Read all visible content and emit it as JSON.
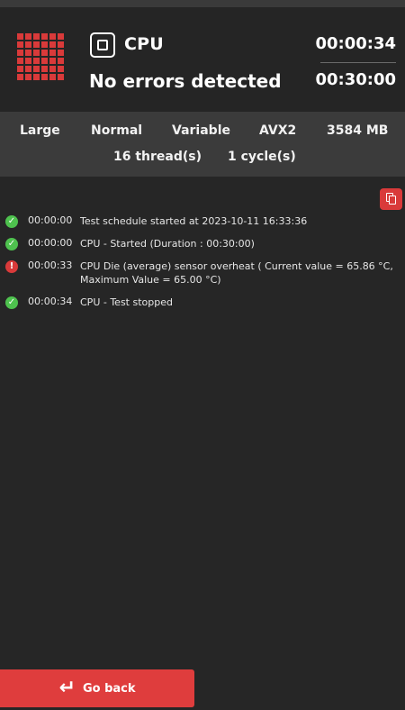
{
  "header": {
    "test_name": "CPU",
    "status": "No errors detected",
    "elapsed_time": "00:00:34",
    "total_duration": "00:30:00"
  },
  "params": {
    "dataset": "Large",
    "mode": "Normal",
    "load": "Variable",
    "instruction_set": "AVX2",
    "memory": "3584 MB",
    "threads": "16 thread(s)",
    "cycles": "1 cycle(s)"
  },
  "log": [
    {
      "status": "ok",
      "time": "00:00:00",
      "message": "Test schedule started at 2023-10-11 16:33:36"
    },
    {
      "status": "ok",
      "time": "00:00:00",
      "message": "CPU - Started (Duration : 00:30:00)"
    },
    {
      "status": "error",
      "time": "00:00:33",
      "message": "CPU Die (average) sensor overheat ( Current value = 65.86 °C, Maximum Value = 65.00 °C)"
    },
    {
      "status": "ok",
      "time": "00:00:34",
      "message": "CPU - Test stopped"
    }
  ],
  "icons": {
    "logo": "grid-logo-icon",
    "test": "stop-square-icon",
    "copy": "copy-icon",
    "ok": "check-circle-icon",
    "error": "exclamation-circle-icon",
    "go_back": "enter-arrow-icon"
  },
  "colors": {
    "accent": "#d93a3a",
    "success": "#4ec24e",
    "background": "#262626",
    "params_background": "#3b3b3b"
  },
  "footer": {
    "go_back_label": "Go back"
  }
}
